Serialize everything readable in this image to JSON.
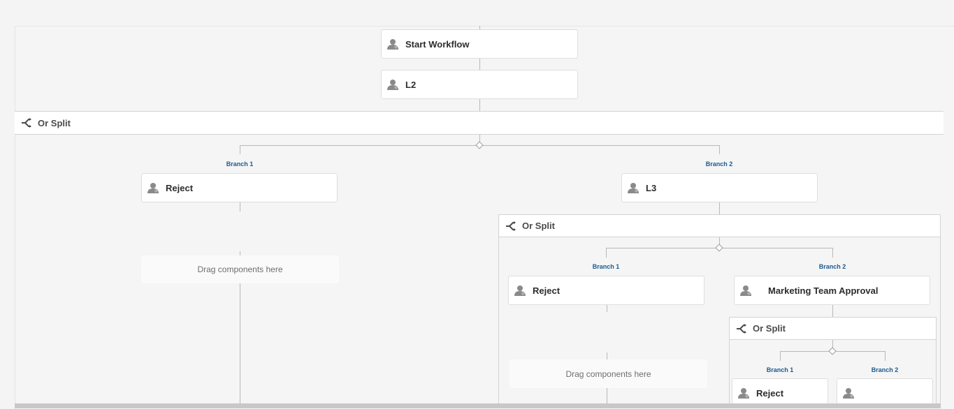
{
  "workflow": {
    "steps": {
      "start": "Start Workflow",
      "l2": "L2",
      "l3": "L3"
    },
    "split_label": "Or Split",
    "branch1_label": "Branch 1",
    "branch2_label": "Branch 2",
    "reject_label": "Reject",
    "marketing_label": "Marketing Team Approval",
    "drop_hint": "Drag components here"
  },
  "icons": {
    "participant_step": "user-icon",
    "or_split": "split-icon"
  },
  "colors": {
    "branch_label": "#1b5a8f",
    "connector": "#b8b8b8",
    "canvas_bg": "#f5f5f5",
    "card_bg": "#ffffff"
  }
}
